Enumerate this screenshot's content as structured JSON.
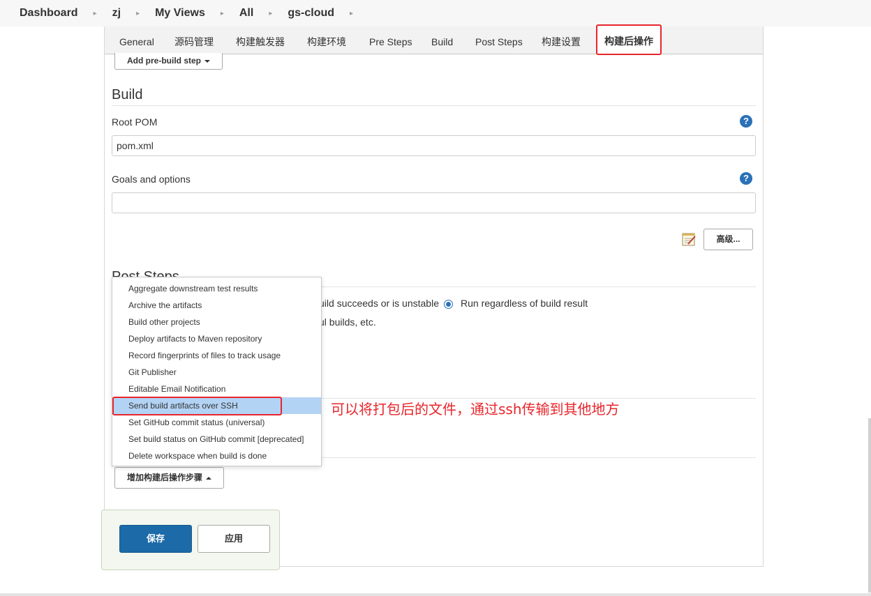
{
  "breadcrumb": [
    "Dashboard",
    "zj",
    "My Views",
    "All",
    "gs-cloud"
  ],
  "tabs": [
    "General",
    "源码管理",
    "构建触发器",
    "构建环境",
    "Pre Steps",
    "Build",
    "Post Steps",
    "构建设置",
    "构建后操作"
  ],
  "active_tab": "构建后操作",
  "pre_steps": {
    "add_button": "Add pre-build step"
  },
  "build": {
    "title": "Build",
    "root_pom_label": "Root POM",
    "root_pom_value": "pom.xml",
    "goals_label": "Goals and options",
    "goals_value": "",
    "help_glyph": "?",
    "advanced_button": "高级..."
  },
  "post_steps": {
    "title": "Post Steps",
    "radio_partial_label": "uild succeeds or is unstable",
    "radio_selected_label": "Run regardless of build result",
    "partial_text": "ul builds, etc."
  },
  "menu": {
    "items": [
      "Aggregate downstream test results",
      "Archive the artifacts",
      "Build other projects",
      "Deploy artifacts to Maven repository",
      "Record fingerprints of files to track usage",
      "Git Publisher",
      "Editable Email Notification",
      "Send build artifacts over SSH",
      "Set GitHub commit status (universal)",
      "Set build status on GitHub commit [deprecated]",
      "Delete workspace when build is done"
    ],
    "highlighted": "Send build artifacts over SSH"
  },
  "annotation": "可以将打包后的文件，通过ssh传输到其他地方",
  "post_build": {
    "add_button": "增加构建后操作步骤"
  },
  "actions": {
    "save": "保存",
    "apply": "应用"
  },
  "colors": {
    "accent_red": "#e8252b",
    "primary_blue": "#1c6aa8",
    "highlight": "#b3d3f5"
  },
  "icons": {
    "help": "help-icon",
    "notepad": "notepad-icon",
    "separator": "chevron-right-icon"
  }
}
